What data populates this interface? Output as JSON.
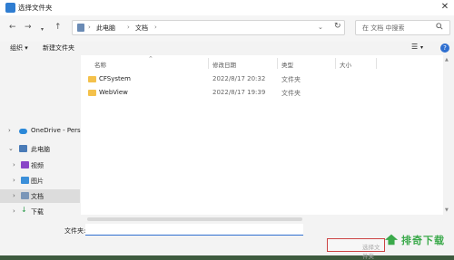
{
  "window": {
    "title": "选择文件夹"
  },
  "address": {
    "crumbs": [
      "此电脑",
      "文档"
    ]
  },
  "search": {
    "placeholder": "在 文档 中搜索"
  },
  "toolbar": {
    "organize_label": "组织 ▾",
    "new_folder_label": "新建文件夹"
  },
  "sidebar": {
    "items": [
      {
        "label": "OneDrive - Pers",
        "icon": "cloud-icon"
      },
      {
        "label": "此电脑",
        "icon": "computer-icon"
      },
      {
        "label": "视频",
        "icon": "video-icon"
      },
      {
        "label": "图片",
        "icon": "picture-icon"
      },
      {
        "label": "文档",
        "icon": "document-icon"
      },
      {
        "label": "下载",
        "icon": "download-icon"
      }
    ]
  },
  "columns": {
    "name": "名称",
    "modified": "修改日期",
    "type": "类型",
    "size": "大小"
  },
  "files": [
    {
      "name": "CFSystem",
      "modified": "2022/8/17 20:32",
      "type": "文件夹"
    },
    {
      "name": "WebView",
      "modified": "2022/8/17 19:39",
      "type": "文件夹"
    }
  ],
  "footer": {
    "folder_label": "文件夹:",
    "folder_value": "",
    "select_label": "选择文件夹"
  },
  "watermark": {
    "text": "排奇下载"
  },
  "colors": {
    "accent": "#2f6fd0",
    "folder": "#f4c14b",
    "watermark": "#3aa94a"
  }
}
